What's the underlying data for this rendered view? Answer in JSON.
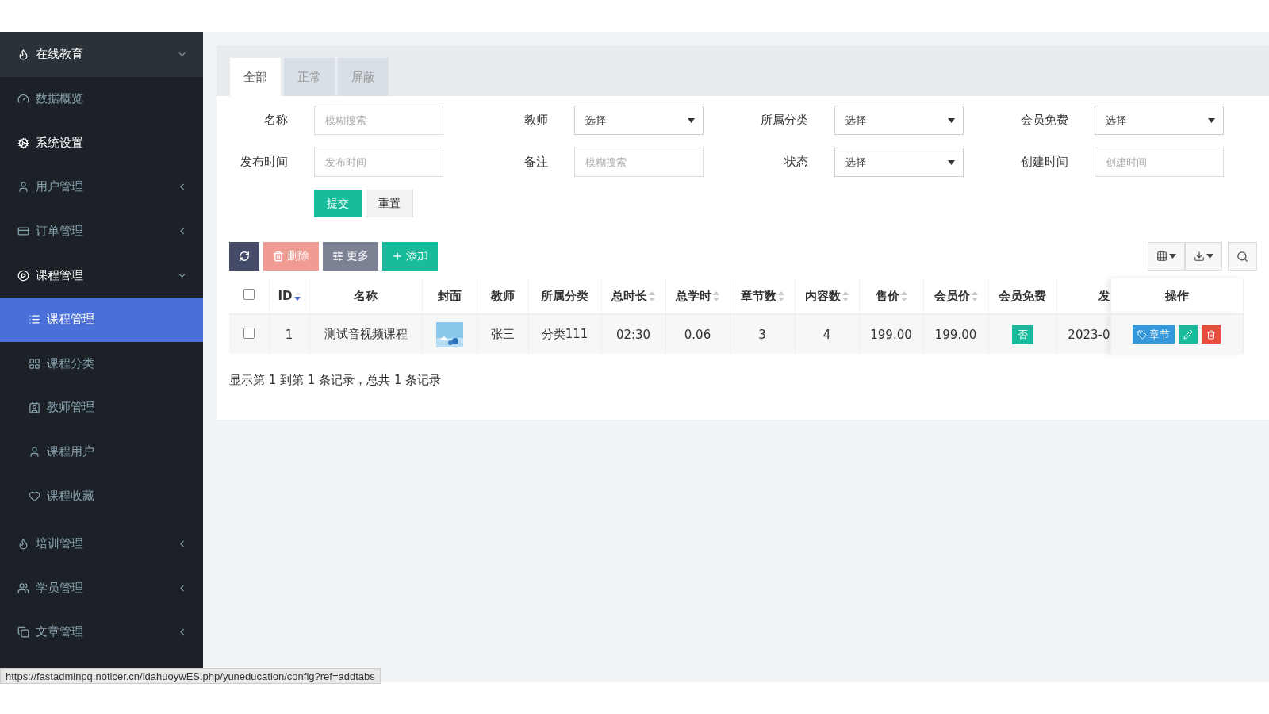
{
  "sidebar": {
    "header": {
      "label": "在线教育",
      "expanded": true
    },
    "items": [
      {
        "label": "数据概览",
        "kind": "link",
        "selected": false,
        "highlighted": false
      },
      {
        "label": "系统设置",
        "kind": "link",
        "selected": false,
        "highlighted": true
      },
      {
        "label": "用户管理",
        "kind": "group",
        "selected": false,
        "highlighted": false,
        "expanded": false
      },
      {
        "label": "订单管理",
        "kind": "group",
        "selected": false,
        "highlighted": false,
        "expanded": false
      },
      {
        "label": "课程管理",
        "kind": "group",
        "selected": false,
        "highlighted": true,
        "expanded": true,
        "children": [
          {
            "label": "课程管理",
            "selected": true
          },
          {
            "label": "课程分类",
            "selected": false
          },
          {
            "label": "教师管理",
            "selected": false
          },
          {
            "label": "课程用户",
            "selected": false
          },
          {
            "label": "课程收藏",
            "selected": false
          }
        ]
      },
      {
        "label": "培训管理",
        "kind": "group",
        "selected": false,
        "highlighted": false,
        "expanded": false
      },
      {
        "label": "学员管理",
        "kind": "group",
        "selected": false,
        "highlighted": false,
        "expanded": false
      },
      {
        "label": "文章管理",
        "kind": "group",
        "selected": false,
        "highlighted": false,
        "expanded": false
      }
    ]
  },
  "tabs": [
    {
      "label": "全部",
      "selected": true
    },
    {
      "label": "正常",
      "selected": false
    },
    {
      "label": "屏蔽",
      "selected": false
    }
  ],
  "filters": [
    {
      "label": "名称",
      "kind": "text",
      "placeholder": "模糊搜索"
    },
    {
      "label": "教师",
      "kind": "select",
      "value": "选择"
    },
    {
      "label": "所属分类",
      "kind": "select",
      "value": "选择"
    },
    {
      "label": "会员免费",
      "kind": "select",
      "value": "选择"
    },
    {
      "label": "发布时间",
      "kind": "text",
      "placeholder": "发布时间"
    },
    {
      "label": "备注",
      "kind": "text",
      "placeholder": "模糊搜索"
    },
    {
      "label": "状态",
      "kind": "select",
      "value": "选择"
    },
    {
      "label": "创建时间",
      "kind": "text",
      "placeholder": "创建时间"
    }
  ],
  "form_buttons": [
    {
      "label": "提交",
      "kind": "primary"
    },
    {
      "label": "重置",
      "kind": "default"
    }
  ],
  "toolbar": [
    {
      "kind": "refresh",
      "disabled": false
    },
    {
      "kind": "delete",
      "label": "删除",
      "disabled": true
    },
    {
      "kind": "more",
      "label": "更多",
      "disabled": false
    },
    {
      "kind": "add",
      "label": "添加",
      "disabled": false
    }
  ],
  "table": {
    "select_all": {
      "checked": false
    },
    "columns": [
      {
        "label": "ID",
        "sortable": true,
        "sorted": true
      },
      {
        "label": "名称",
        "sortable": false,
        "sorted": false
      },
      {
        "label": "封面",
        "sortable": false,
        "sorted": false
      },
      {
        "label": "教师",
        "sortable": false,
        "sorted": false
      },
      {
        "label": "所属分类",
        "sortable": false,
        "sorted": false
      },
      {
        "label": "总时长",
        "sortable": true,
        "sorted": false
      },
      {
        "label": "总学时",
        "sortable": true,
        "sorted": false
      },
      {
        "label": "章节数",
        "sortable": true,
        "sorted": false
      },
      {
        "label": "内容数",
        "sortable": true,
        "sorted": false
      },
      {
        "label": "售价",
        "sortable": true,
        "sorted": false
      },
      {
        "label": "会员价",
        "sortable": true,
        "sorted": false
      },
      {
        "label": "会员免费",
        "sortable": false,
        "sorted": false
      },
      {
        "label": "发",
        "sortable": false,
        "sorted": false
      },
      {
        "label": "操作",
        "sortable": false,
        "sorted": false
      }
    ],
    "rows": [
      {
        "checked": false,
        "id": "1",
        "name": "测试音视频课程",
        "teacher": "张三",
        "category": "分类111",
        "duration": "02:30",
        "hours": "0.06",
        "chapters": "3",
        "contents": "4",
        "price": "199.00",
        "member_price": "199.00",
        "member_free": "否",
        "publish_time": "2023-0",
        "chapter_button": "章节"
      }
    ]
  },
  "pagination_info": "显示第 1 到第 1 条记录，总共 1 条记录",
  "status_bar": {
    "url": "https://fastadminpq.noticer.cn/idahuoywES.php/yuneducation/config?ref=addtabs"
  }
}
